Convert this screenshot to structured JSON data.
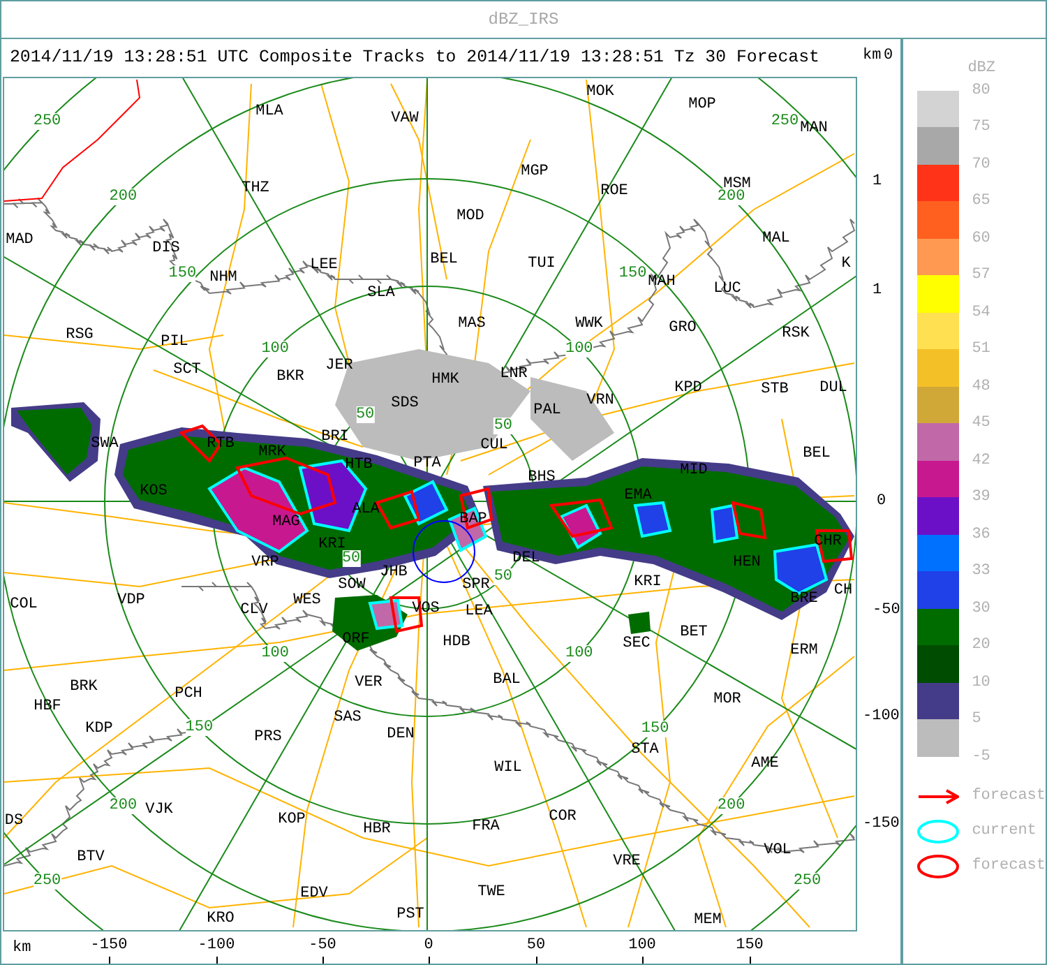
{
  "window": {
    "title": "dBZ_IRS"
  },
  "caption": "2014/11/19 13:28:51 UTC Composite Tracks to 2014/11/19 13:28:51 Tz 30 Forecast",
  "map": {
    "places": [
      "MLA",
      "VAW",
      "MOK",
      "MOP",
      "MAN",
      "THZ",
      "MGP",
      "ROE",
      "MSM",
      "MOD",
      "MAD",
      "DIS",
      "LEE",
      "BEL",
      "TUI",
      "MAL",
      "K",
      "NHM",
      "SLA",
      "MAH",
      "LUC",
      "RSG",
      "PIL",
      "MAS",
      "WWK",
      "GRO",
      "RSK",
      "SCT",
      "BKR",
      "JER",
      "HMK",
      "LNR",
      "KPD",
      "STB",
      "DUL",
      "SDS",
      "PAL",
      "VRN",
      "SWA",
      "RTB",
      "MRK",
      "BRI",
      "CUL",
      "BEL",
      "HTB",
      "PTA",
      "BHS",
      "MID",
      "KOS",
      "EMA",
      "MAG",
      "ALA",
      "BAP",
      "KRI",
      "CHR",
      "VRP",
      "DEL",
      "HEN",
      "SOW",
      "JHB",
      "SPR",
      "KRI",
      "CH",
      "COL",
      "VDP",
      "CLV",
      "WES",
      "VOS",
      "LEA",
      "BRE",
      "ORF",
      "HDB",
      "SEC",
      "BET",
      "ERM",
      "HBF",
      "BRK",
      "PCH",
      "VER",
      "BAL",
      "MOR",
      "KDP",
      "PRS",
      "SAS",
      "DEN",
      "WIL",
      "STA",
      "AME",
      "DS",
      "VJK",
      "KOP",
      "HBR",
      "FRA",
      "COR",
      "BTV",
      "VRE",
      "VOL",
      "EDV",
      "TWE",
      "KRO",
      "PST",
      "MEM"
    ],
    "range_labels": [
      "250",
      "200",
      "150",
      "100",
      "50",
      "250",
      "200",
      "150",
      "100",
      "50",
      "50",
      "100",
      "150",
      "200",
      "250",
      "50",
      "100",
      "150",
      "200",
      "250"
    ],
    "x_axis": {
      "unit": "km",
      "ticks": [
        "-150",
        "-100",
        "-50",
        "0",
        "50",
        "100",
        "150"
      ]
    },
    "y_axis": {
      "unit": "km",
      "ticks": [
        "0",
        "1",
        "1",
        "0",
        "-50",
        "-100",
        "-150"
      ]
    }
  },
  "legend": {
    "unit": "dBZ",
    "scale": [
      {
        "label": "80",
        "color": "#d3d3d3"
      },
      {
        "label": "75",
        "color": "#a8a8a8"
      },
      {
        "label": "70",
        "color": "#ff3317"
      },
      {
        "label": "65",
        "color": "#ff6020"
      },
      {
        "label": "60",
        "color": "#ff9850"
      },
      {
        "label": "57",
        "color": "#ffff00"
      },
      {
        "label": "54",
        "color": "#ffe050"
      },
      {
        "label": "51",
        "color": "#f4c028"
      },
      {
        "label": "48",
        "color": "#d0a838"
      },
      {
        "label": "45",
        "color": "#c068a8"
      },
      {
        "label": "42",
        "color": "#c81890"
      },
      {
        "label": "39",
        "color": "#6c10c8"
      },
      {
        "label": "36",
        "color": "#0070ff"
      },
      {
        "label": "33",
        "color": "#2040e8"
      },
      {
        "label": "30",
        "color": "#006c00"
      },
      {
        "label": "20",
        "color": "#004c00"
      },
      {
        "label": "10",
        "color": "#443c88"
      },
      {
        "label": "5",
        "color": "#bcbcbc"
      }
    ],
    "bottom_label": "-5",
    "symbols": [
      {
        "kind": "arrow",
        "label": "forecast",
        "color": "#ff0000"
      },
      {
        "kind": "ellipse",
        "label": "current",
        "color": "#00ffff"
      },
      {
        "kind": "ellipse",
        "label": "forecast",
        "color": "#ff0000"
      }
    ]
  }
}
